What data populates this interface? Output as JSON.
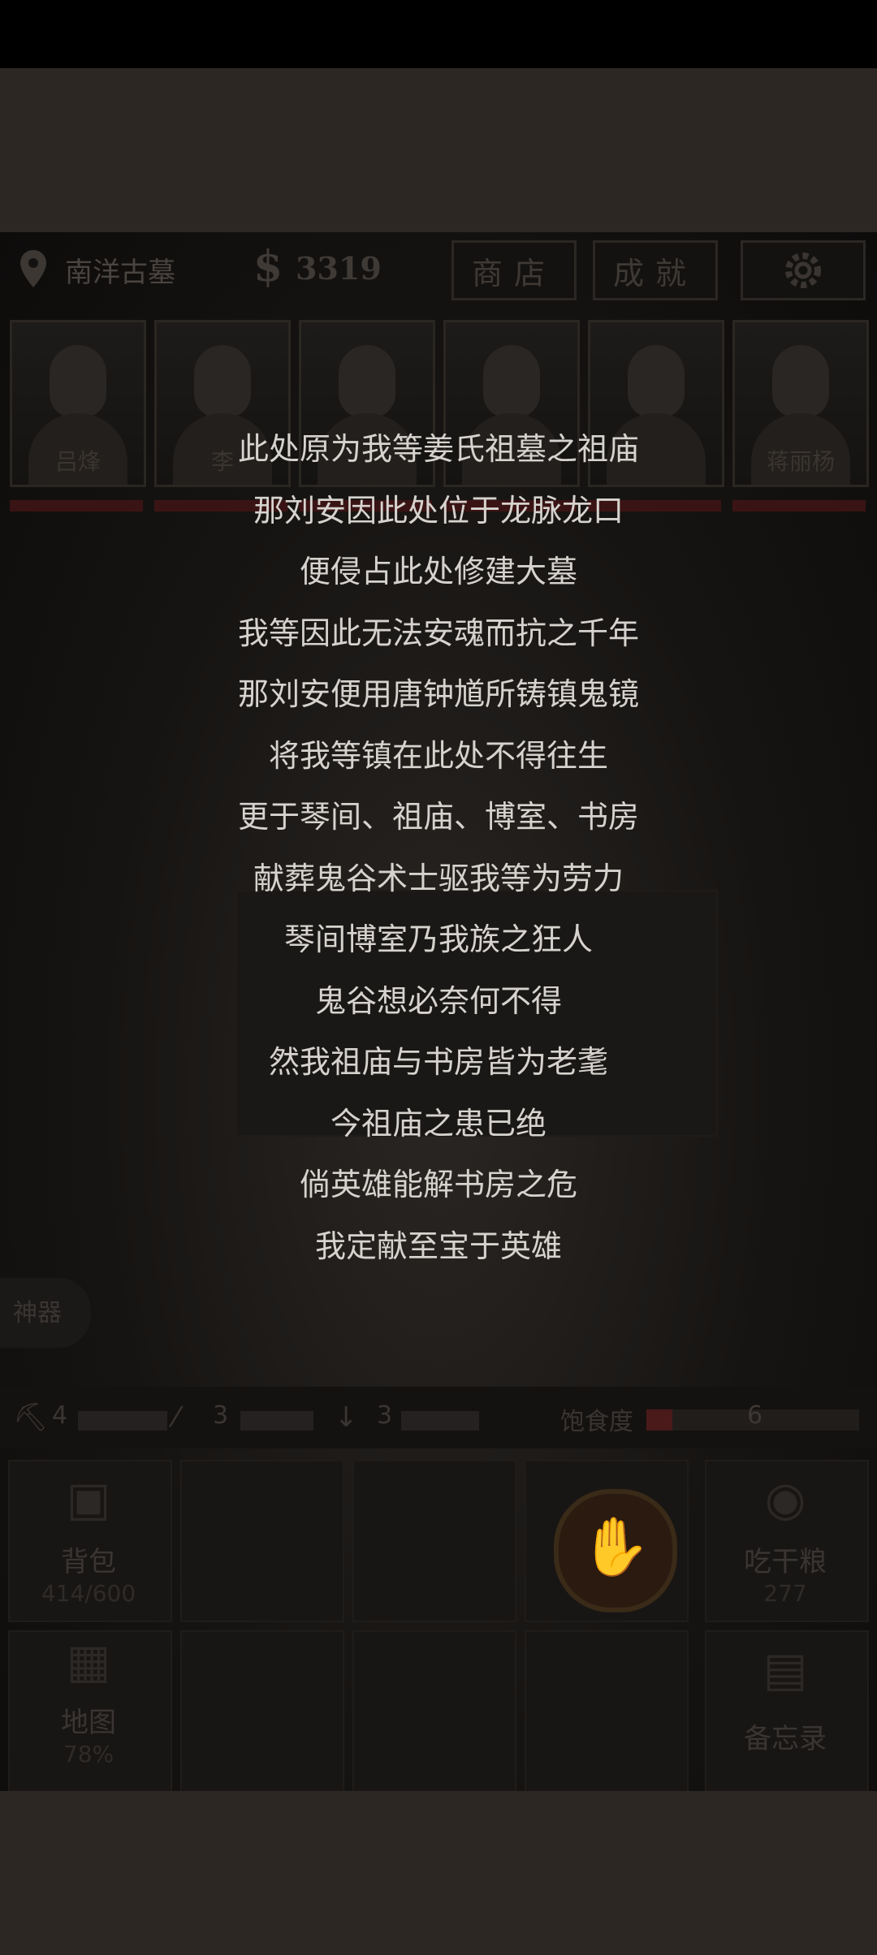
{
  "top": {
    "location": "南洋古墓",
    "money": "3319",
    "shop_label": "商店",
    "achievements_label": "成就",
    "icons": {
      "location": "map-pin-icon",
      "money": "dollar-icon",
      "settings": "gear-icon"
    }
  },
  "team": [
    {
      "name": "吕烽"
    },
    {
      "name": "李"
    },
    {
      "name": ""
    },
    {
      "name": ""
    },
    {
      "name": ""
    },
    {
      "name": "蒋丽杨"
    }
  ],
  "story": {
    "lines": [
      "此处原为我等姜氏祖墓之祖庙",
      "那刘安因此处位于龙脉龙口",
      "便侵占此处修建大墓",
      "我等因此无法安魂而抗之千年",
      "那刘安便用唐钟馗所铸镇鬼镜",
      "将我等镇在此处不得往生",
      "更于琴间、祖庙、博室、书房",
      "献葬鬼谷术士驱我等为劳力",
      "琴间博室乃我族之狂人",
      "鬼谷想必奈何不得",
      "然我祖庙与书房皆为老耄",
      "今祖庙之患已绝",
      "倘英雄能解书房之危",
      "我定献至宝于英雄"
    ]
  },
  "side": {
    "artifact_label": "神器"
  },
  "tools": [
    {
      "icon": "pickaxe-icon",
      "count": "4"
    },
    {
      "icon": "crowbar-icon",
      "count": "3"
    },
    {
      "icon": "shovel-icon",
      "count": "3"
    }
  ],
  "hunger": {
    "label": "饱食度",
    "value": "6"
  },
  "actions": {
    "backpack": {
      "label": "背包",
      "sub": "414/600"
    },
    "eat": {
      "label": "吃干粮",
      "sub": "277"
    },
    "map": {
      "label": "地图",
      "sub": "78%"
    },
    "memo": {
      "label": "备忘录"
    }
  }
}
